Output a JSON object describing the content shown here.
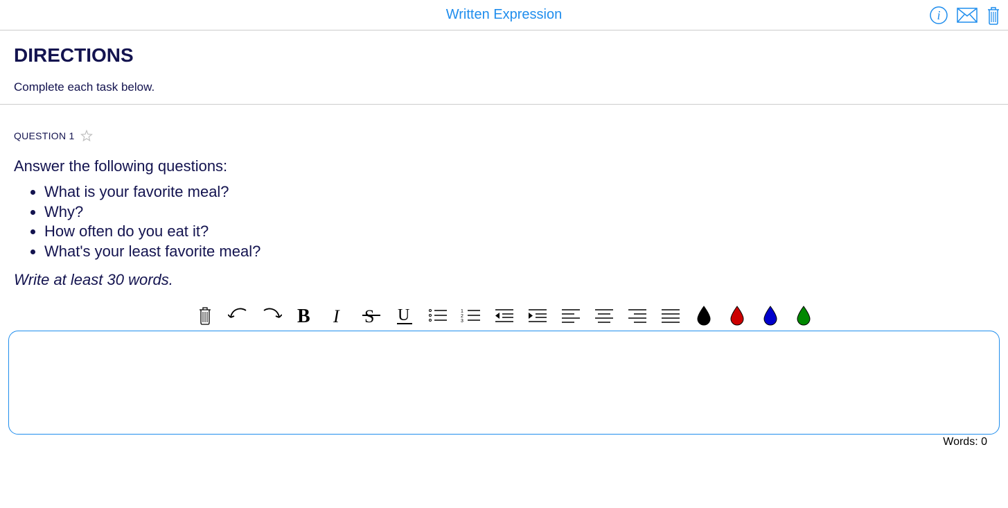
{
  "header": {
    "title": "Written Expression"
  },
  "directions": {
    "heading": "DIRECTIONS",
    "subtext": "Complete each task below."
  },
  "question": {
    "label": "QUESTION 1",
    "prompt": "Answer the following questions:",
    "bullets": [
      "What is your favorite meal?",
      "Why?",
      "How often do you eat it?",
      "What's your least favorite meal?"
    ],
    "instruction": "Write at least 30 words."
  },
  "editor": {
    "wordcount_label": "Words:",
    "wordcount_value": "0"
  },
  "colors": {
    "accent": "#1f8ded",
    "black": "#000000",
    "red": "#cc0000",
    "blue": "#0000cc",
    "green": "#008800"
  }
}
